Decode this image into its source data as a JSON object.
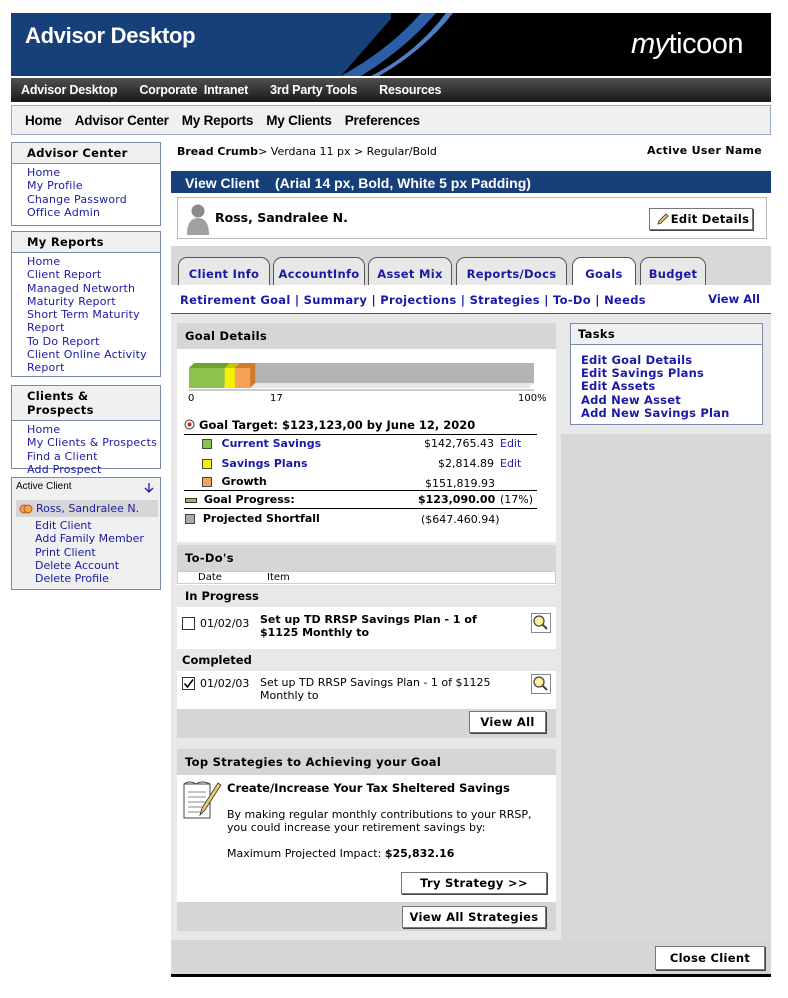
{
  "header": {
    "title": "Advisor Desktop",
    "logo": "myticoon"
  },
  "topnav": [
    "Advisor Desktop",
    "Corporate  Intranet",
    "3rd Party Tools",
    "Resources"
  ],
  "mainnav": [
    "Home",
    "Advisor Center",
    "My Reports",
    "My Clients",
    "Preferences"
  ],
  "advisor_center": {
    "title": "Advisor Center",
    "items": [
      "Home",
      "My Profile",
      "Change Password",
      "Office Admin"
    ]
  },
  "my_reports": {
    "title": "My Reports",
    "items": [
      "Home",
      "Client Report",
      "Managed Networth",
      "Maturity Report",
      "Short Term Maturity",
      "Report",
      "To Do Report",
      "Client Online Activity",
      "Report"
    ]
  },
  "clients_prospects": {
    "title": "Clients & Prospects",
    "items": [
      "Home",
      "My Clients & Prospects",
      "Find a Client",
      "Add Prospect"
    ]
  },
  "active_client": {
    "title": "Active Client",
    "name": "Ross, Sandralee N.",
    "items": [
      "Edit Client",
      "Add Family Member",
      "Print Client",
      "Delete Account",
      "Delete Profile"
    ]
  },
  "breadcrumb": {
    "label": "Bread Crumb",
    "sep": ">",
    "text": "Verdana 11 px > Regular/Bold"
  },
  "active_user": "Active User Name",
  "view_client": "View Client    (Arial 14 px, Bold, White 5 px Padding)",
  "client_name": "Ross, Sandralee N.",
  "edit_details": "Edit Details",
  "tabs": [
    "Client Info",
    "AccountInfo",
    "Asset Mix",
    "Reports/Docs",
    "Goals",
    "Budget"
  ],
  "subnav": "Retirement Goal | Summary | Projections | Strategies | To-Do | Needs",
  "subnav_viewall": "View All",
  "goal": {
    "title": "Goal Details",
    "bar": {
      "green": 0.105,
      "yellow": 0.03,
      "orange": 0.045,
      "zero": "0",
      "mid": "17",
      "max": "100%"
    },
    "target": "Goal Target: $123,123,00 by June 12, 2020",
    "rows": [
      {
        "label": "Current Savings",
        "value": "$142,765.43",
        "edit": "Edit",
        "color": "#8dc34a"
      },
      {
        "label": "Savings Plans",
        "value": "$2,814.89",
        "edit": "Edit",
        "color": "#f7f200"
      },
      {
        "label": "Growth",
        "value": "$151,819.93",
        "edit": "",
        "color": "#f5a352"
      }
    ],
    "progress_label": "Goal Progress:",
    "progress_value": "$123,090.00",
    "progress_pct": "(17%)",
    "shortfall_label": "Projected Shortfall",
    "shortfall_value": "($647.460.94)"
  },
  "tasks": {
    "title": "Tasks",
    "items": [
      "Edit Goal Details",
      "Edit Savings Plans",
      "Edit Assets",
      "Add New Asset",
      "Add New Savings Plan"
    ]
  },
  "todo": {
    "title": "To-Do's",
    "col_date": "Date",
    "col_item": "Item",
    "inprogress": "In Progress",
    "ip_date": "01/02/03",
    "ip_text1": "Set up TD RRSP Savings Plan - 1 of",
    "ip_text2": "$1125 Monthly to",
    "completed": "Completed",
    "c_date": "01/02/03",
    "c_text1": "Set up TD RRSP Savings Plan - 1 of $1125",
    "c_text2": "Monthly to",
    "viewall": "View All"
  },
  "strategy": {
    "title": "Top Strategies to Achieving your Goal",
    "heading": "Create/Increase Your Tax Sheltered Savings",
    "desc1": "By making regular monthly contributions to your RRSP,",
    "desc2": "you could increase your retirement savings by:",
    "impact_label": "Maximum Projected Impact:",
    "impact_value": "$25,832.16",
    "try": "Try Strategy >>",
    "viewall": "View All Strategies"
  },
  "close": "Close Client"
}
